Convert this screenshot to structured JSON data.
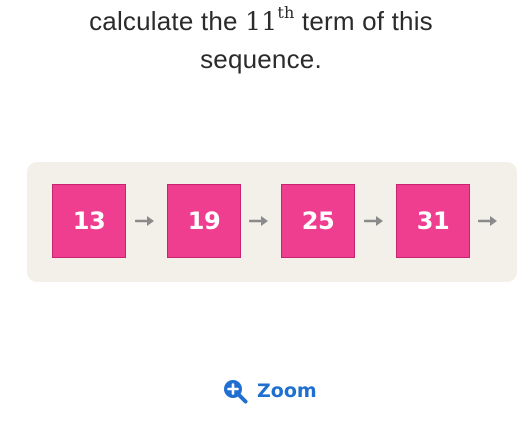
{
  "question": {
    "text_before": "calculate the ",
    "n": "11",
    "sup": "th",
    "text_after": " term of this",
    "line2": "sequence."
  },
  "sequence": {
    "terms": [
      "13",
      "19",
      "25",
      "31"
    ]
  },
  "colors": {
    "tile": "#ef3d8f",
    "panel": "#f2f0e8",
    "arrow": "#8a8a8a",
    "zoom": "#1f6fd1"
  },
  "zoom": {
    "label": "Zoom",
    "icon": "zoom-in-icon"
  }
}
